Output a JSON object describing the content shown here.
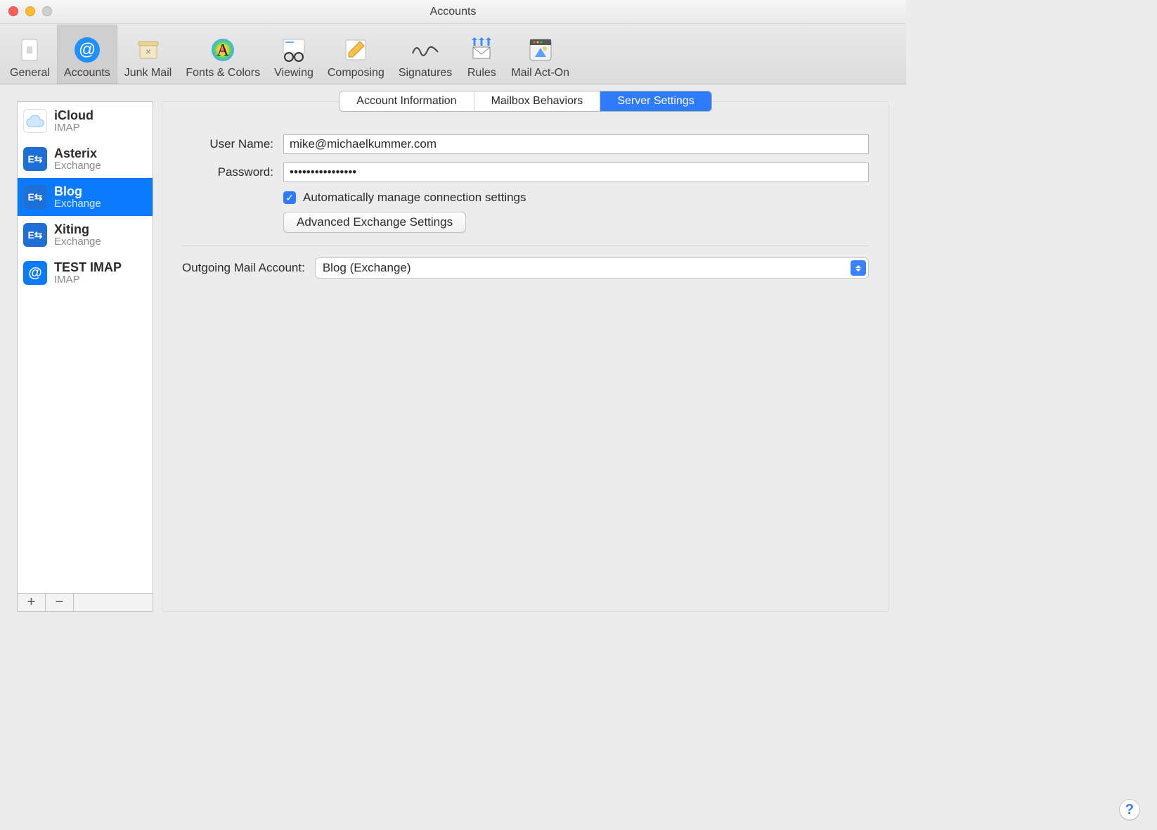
{
  "window": {
    "title": "Accounts"
  },
  "toolbar": {
    "items": [
      {
        "label": "General"
      },
      {
        "label": "Accounts"
      },
      {
        "label": "Junk Mail"
      },
      {
        "label": "Fonts & Colors"
      },
      {
        "label": "Viewing"
      },
      {
        "label": "Composing"
      },
      {
        "label": "Signatures"
      },
      {
        "label": "Rules"
      },
      {
        "label": "Mail Act-On"
      }
    ],
    "selected_index": 1
  },
  "accounts": {
    "items": [
      {
        "name": "iCloud",
        "subtitle": "IMAP",
        "icon": "icloud"
      },
      {
        "name": "Asterix",
        "subtitle": "Exchange",
        "icon": "exchange"
      },
      {
        "name": "Blog",
        "subtitle": "Exchange",
        "icon": "exchange"
      },
      {
        "name": "Xiting",
        "subtitle": "Exchange",
        "icon": "exchange"
      },
      {
        "name": "TEST IMAP",
        "subtitle": "IMAP",
        "icon": "imap"
      }
    ],
    "selected_index": 2,
    "add_label": "+",
    "remove_label": "−"
  },
  "tabs": {
    "items": [
      "Account Information",
      "Mailbox Behaviors",
      "Server Settings"
    ],
    "selected_index": 2
  },
  "form": {
    "username_label": "User Name:",
    "username_value": "mike@michaelkummer.com",
    "password_label": "Password:",
    "password_value": "••••••••••••••••",
    "auto_manage_label": "Automatically manage connection settings",
    "auto_manage_checked": true,
    "advanced_button": "Advanced Exchange Settings",
    "outgoing_label": "Outgoing Mail Account:",
    "outgoing_value": "Blog (Exchange)"
  },
  "help_label": "?"
}
